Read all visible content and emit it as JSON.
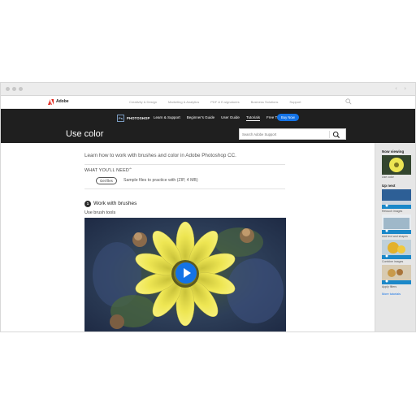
{
  "topnav": {
    "brand": "Adobe",
    "links": [
      "Creativity & Design",
      "Marketing & Analytics",
      "PDF & E-signatures",
      "Business Solutions",
      "Support"
    ]
  },
  "product_bar": {
    "badge": "Ps",
    "product": "PHOTOSHOP",
    "links": [
      "Learn & Support",
      "Beginner's Guide",
      "User Guide",
      "Tutorials",
      "Free Trial"
    ],
    "active_link": "Tutorials",
    "buy_label": "Buy Now",
    "page_title": "Use color",
    "search_placeholder": "Search Adobe Support"
  },
  "content": {
    "intro": "Learn how to work with brushes and color in Adobe Photoshop CC.",
    "need_label": "WHAT YOU'LL NEED",
    "get_files_label": "Get files",
    "sample_text": "Sample files to practice with (ZIP, 4 MB)",
    "step_number": "1",
    "step_title": "Work with brushes",
    "step_subtitle": "Use brush tools"
  },
  "sidebar": {
    "now_viewing_label": "Now viewing",
    "now_viewing": "Use color",
    "up_next_label": "Up next",
    "items": [
      "Retouch images",
      "Add text and shapes",
      "Combine images",
      "Apply filters"
    ],
    "more_label": "More tutorials"
  },
  "colors": {
    "accent": "#1473e6",
    "darkbar": "#1f1f1f",
    "flower": "#f0e84a"
  }
}
